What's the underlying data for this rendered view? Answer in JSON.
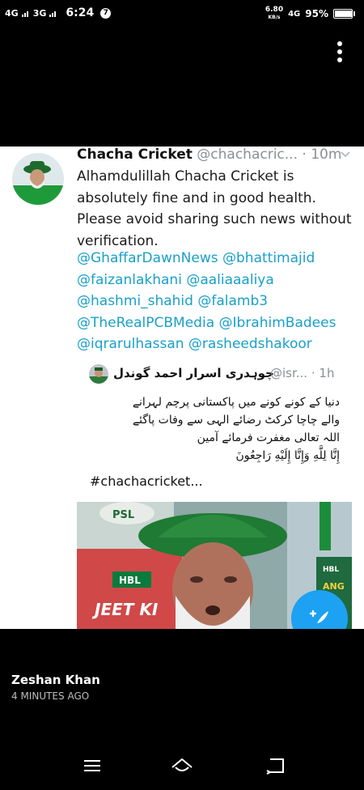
{
  "status_bar": {
    "network_1": "4G",
    "network_2": "3G",
    "time": "6:24",
    "notification_badge": "7",
    "speed_value": "6.80",
    "speed_unit": "KB/s",
    "network_3": "4G",
    "battery_text": "95%",
    "battery_level": 0.95
  },
  "tweet": {
    "author_name": "Chacha Cricket",
    "author_handle": "@chachacric...",
    "separator": "·",
    "time_ago": "10m",
    "text_lines": [
      "Alhamdulillah Chacha Cricket is",
      "absolutely fine and in good health.",
      "Please avoid sharing such news without",
      "verification."
    ],
    "mention_lines": [
      "@GhaffarDawnNews @bhattimajid",
      "@faizanlakhani @aaliaaaliya",
      "@hashmi_shahid @falamb3",
      "@TheRealPCBMedia @IbrahimBadees",
      "@iqrarulhassan @rasheedshakoor"
    ]
  },
  "quoted_tweet": {
    "author_name": "چوہدری اسرار احمد گوندل",
    "author_handle": "@isr...",
    "separator": "·",
    "time_ago": "1h",
    "text_lines": [
      "دنیا کے کونے کونے میں پاکستانی پرچم لہرانے",
      "والے چاچا کرکٹ رضائے الہی سے وفات پاگئے",
      "اللہ تعالی مغفرت فرمائے آمین",
      "إِنَّا لِلَّهِ وَإِنَّا إِلَيْهِ رَاجِعُونَ"
    ],
    "hashtag": "#chachacricket...",
    "photo_signage": {
      "psl": "PSL",
      "hbl": "HBL",
      "banner": "JEET KI",
      "right_hbl": "HBL",
      "right_sign": "ANG"
    }
  },
  "story": {
    "user_name": "Zeshan Khan",
    "time_ago": "4 MINUTES AGO"
  },
  "colors": {
    "link": "#1aa0c8",
    "fab": "#1da1f2",
    "muted": "#8a8f94"
  },
  "icons": {
    "more": "more-vertical-icon",
    "chevron": "chevron-down-icon",
    "compose": "compose-tweet-icon",
    "nav_menu": "menu-icon",
    "nav_home": "home-icon",
    "nav_back": "back-icon"
  }
}
